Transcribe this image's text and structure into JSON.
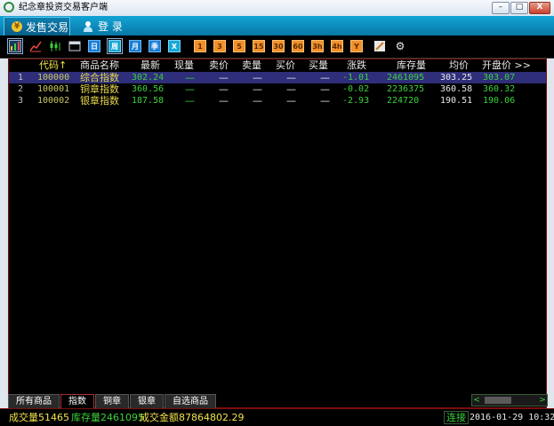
{
  "window": {
    "title": "纪念章投资交易客户端",
    "btn_min": "–",
    "btn_max": "□",
    "btn_close": "X"
  },
  "nav": {
    "active_tab": "发售交易",
    "login_tab": "登 录"
  },
  "toolbar": {
    "period_day": "日",
    "period_week": "周",
    "period_month": "月",
    "period_season": "季",
    "period_year": "X",
    "min_buttons": [
      "1",
      "3",
      "5",
      "15",
      "30",
      "60",
      "3h",
      "4h",
      "Y"
    ]
  },
  "table": {
    "headers": [
      "",
      "代码↑",
      "商品名称",
      "最新",
      "现量",
      "卖价",
      "卖量",
      "买价",
      "买量",
      "涨跌",
      "库存量",
      "均价",
      "开盘价 >>"
    ],
    "rows": [
      {
        "idx": "1",
        "code": "100000",
        "name": "综合指数",
        "last": "302.24",
        "vol": "—",
        "ask": "—",
        "ask_vol": "—",
        "bid": "—",
        "bid_vol": "—",
        "change": "-1.01",
        "stock": "2461095",
        "avg": "303.25",
        "open": "303.07"
      },
      {
        "idx": "2",
        "code": "100001",
        "name": "铜章指数",
        "last": "360.56",
        "vol": "—",
        "ask": "—",
        "ask_vol": "—",
        "bid": "—",
        "bid_vol": "—",
        "change": "-0.02",
        "stock": "2236375",
        "avg": "360.58",
        "open": "360.32"
      },
      {
        "idx": "3",
        "code": "100002",
        "name": "银章指数",
        "last": "187.58",
        "vol": "—",
        "ask": "—",
        "ask_vol": "—",
        "bid": "—",
        "bid_vol": "—",
        "change": "-2.93",
        "stock": "224720",
        "avg": "190.51",
        "open": "190.06"
      }
    ]
  },
  "sheet_tabs": [
    "所有商品",
    "指数",
    "铜章",
    "银章",
    "自选商品"
  ],
  "status": {
    "volume": "成交量51465",
    "stock": "库存量2461095",
    "amount": "成交金额87864802.29",
    "connection": "连接",
    "datetime": "2016-01-29 10:32"
  },
  "colors": {
    "selected_row": "#2e2e7a",
    "up_green": "#3cd23c",
    "name_yellow": "#e6d84a",
    "code_yellow": "#c8c860",
    "border_red": "#7a0e0e"
  }
}
